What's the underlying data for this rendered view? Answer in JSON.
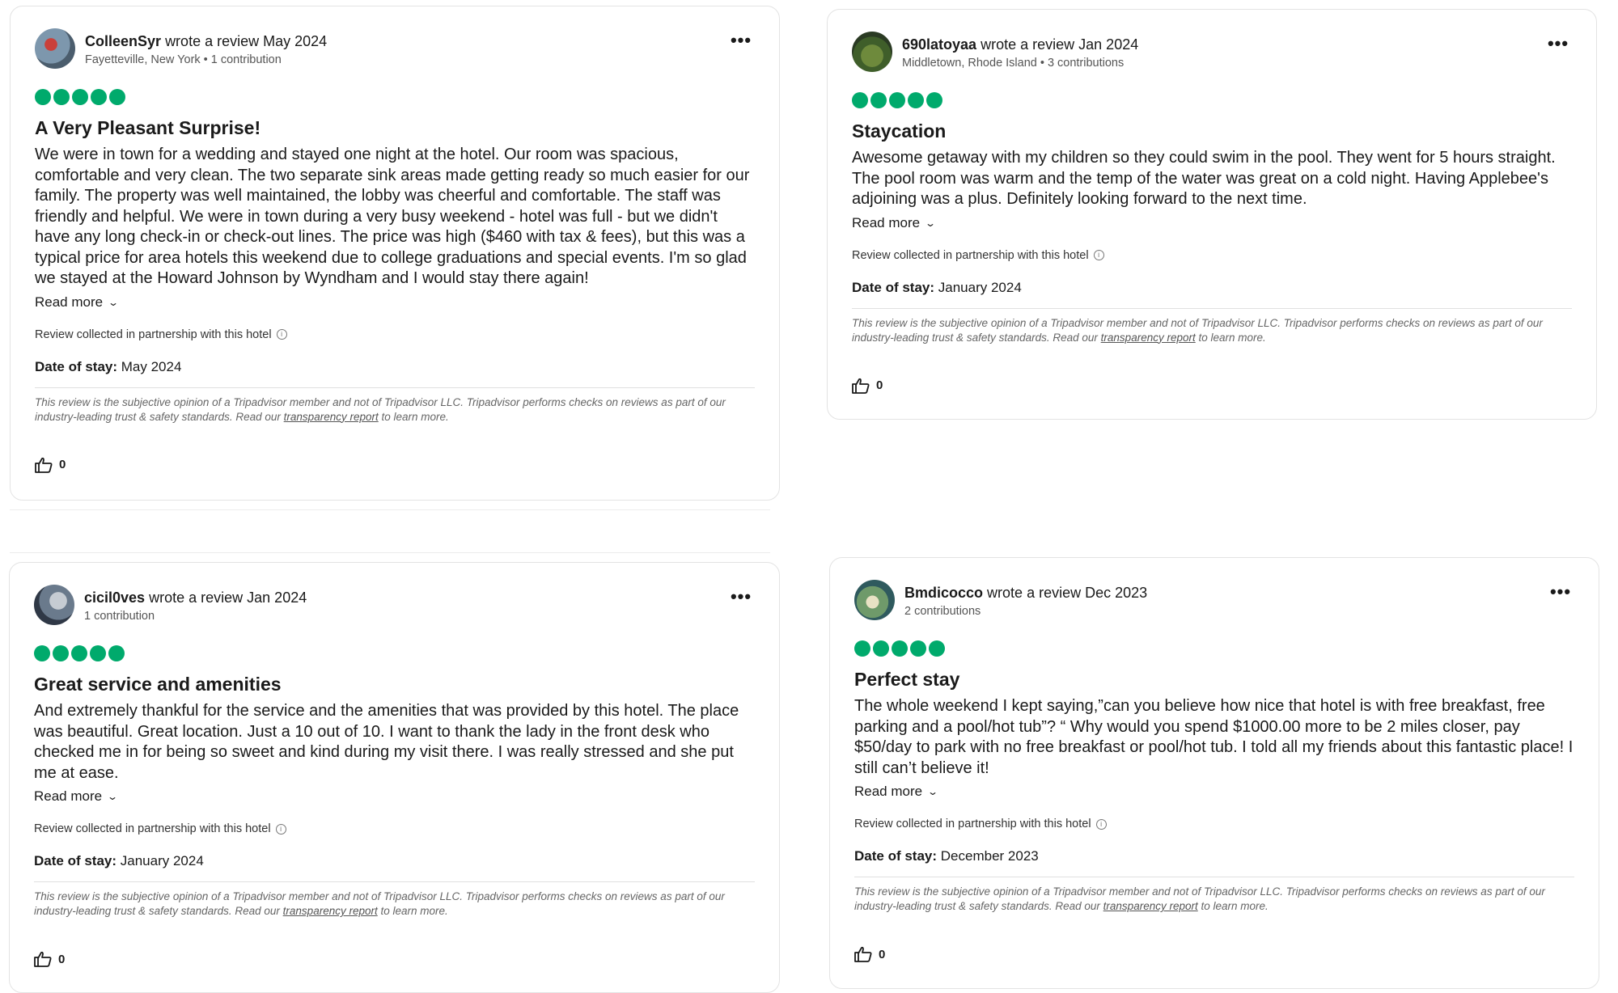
{
  "common": {
    "wrote_review": "wrote a review",
    "read_more": "Read more",
    "collected": "Review collected in partnership with this hotel",
    "date_of_stay_label": "Date of stay:",
    "disclaimer_before": "This review is the subjective opinion of a Tripadvisor member and not of Tripadvisor LLC. Tripadvisor performs checks on reviews as part of our industry-leading trust & safety standards. Read our ",
    "disclaimer_link": "transparency report",
    "disclaimer_after": " to learn more.",
    "more_icon": "more-dots-icon",
    "thumb_icon": "thumbs-up-icon",
    "bubble_color": "#00aa6c"
  },
  "reviews": [
    {
      "username": "ColleenSyr",
      "review_date": "May 2024",
      "location": "Fayetteville, New York",
      "contributions": "1 contribution",
      "rating": 5,
      "title": "A Very Pleasant Surprise!",
      "body": "We were in town for a wedding and stayed one night at the hotel. Our room was spacious, comfortable and very clean. The two separate sink areas made getting ready so much easier for our family. The property was well maintained, the lobby was cheerful and comfortable. The staff was friendly and helpful. We were in town during a very busy weekend - hotel was full - but we didn't have any long check-in or check-out lines. The price was high ($460 with tax & fees), but this was a typical price for area hotels this weekend due to college graduations and special events. I'm so glad we stayed at the Howard Johnson by Wyndham and I would stay there again!",
      "date_of_stay": "May 2024",
      "helpful_count": "0"
    },
    {
      "username": "690latoyaa",
      "review_date": "Jan 2024",
      "location": "Middletown, Rhode Island",
      "contributions": "3 contributions",
      "rating": 5,
      "title": "Staycation",
      "body": "Awesome getaway with my children so they could swim in the pool. They went for 5 hours straight. The pool room was warm and the temp of the water was great on a cold night. Having Applebee's adjoining was a plus. Definitely looking forward to the next time.",
      "date_of_stay": "January 2024",
      "helpful_count": "0"
    },
    {
      "username": "cicil0ves",
      "review_date": "Jan 2024",
      "location": "",
      "contributions": "1 contribution",
      "rating": 5,
      "title": "Great service and amenities",
      "body": "And extremely thankful for the service and the amenities that was provided by this hotel. The place was beautiful. Great location. Just a 10 out of 10. I want to thank the lady in the front desk who checked me in for being so sweet and kind during my visit there. I was really stressed and she put me at ease.",
      "date_of_stay": "January 2024",
      "helpful_count": "0"
    },
    {
      "username": "Bmdicocco",
      "review_date": "Dec 2023",
      "location": "",
      "contributions": "2 contributions",
      "rating": 5,
      "title": "Perfect stay",
      "body": "The whole weekend I kept saying,”can you believe how nice that hotel is with free breakfast, free parking and a pool/hot tub”? “ Why would you spend $1000.00 more to be 2 miles closer, pay $50/day to park with no free breakfast or pool/hot tub. I told all my friends about this fantastic place! I still can’t believe it!",
      "date_of_stay": "December 2023",
      "helpful_count": "0"
    }
  ]
}
